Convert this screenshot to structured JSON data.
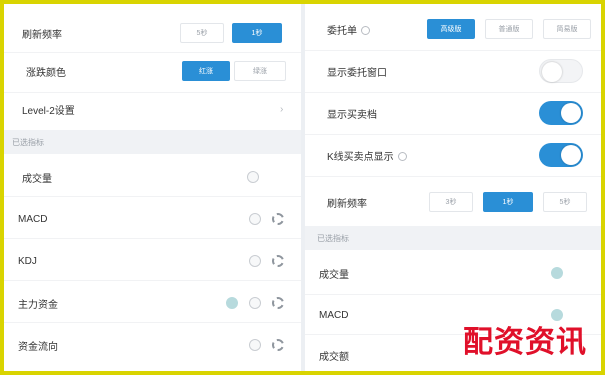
{
  "left": {
    "refresh": {
      "label": "刷新频率",
      "options": [
        "5秒",
        "1秒"
      ]
    },
    "color": {
      "label": "涨跌颜色",
      "options": [
        "红涨",
        "绿涨"
      ]
    },
    "level2": {
      "label": "Level-2设置"
    },
    "section": "已选指标",
    "indicators": [
      "成交量",
      "MACD",
      "KDJ",
      "主力资金",
      "资金流向"
    ]
  },
  "right": {
    "trade": {
      "label": "委托单",
      "options": [
        "高级版",
        "普通版",
        "简易版"
      ]
    },
    "window": {
      "label": "显示委托窗口"
    },
    "cost": {
      "label": "显示买卖档"
    },
    "kline": {
      "label": "K线买卖点显示"
    },
    "refresh": {
      "label": "刷新频率",
      "options": [
        "3秒",
        "1秒",
        "5秒"
      ]
    },
    "section": "已选指标",
    "indicators": [
      "成交量",
      "MACD",
      "成交额"
    ]
  },
  "watermark": "配资资讯",
  "colors": {
    "accent": "#2a8fd6",
    "frame": "#d9d400",
    "watermark": "#e0102a"
  },
  "toggles": {
    "window": false,
    "cost": true,
    "kline": true
  }
}
